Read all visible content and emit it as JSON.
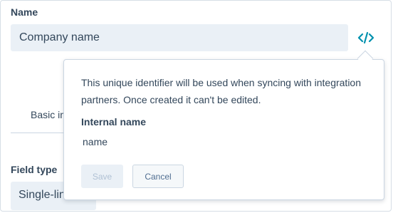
{
  "name_field": {
    "label": "Name",
    "value": "Company name"
  },
  "code_toggle": {
    "icon": "code-icon",
    "color": "#0091ae"
  },
  "tab": {
    "label": "Basic in"
  },
  "field_type": {
    "label": "Field type",
    "value": "Single-lin"
  },
  "popover": {
    "description": "This unique identifier will be used when syncing with integration partners. Once created it can't be edited.",
    "internal_name_label": "Internal name",
    "internal_name_value": "name",
    "save_label": "Save",
    "cancel_label": "Cancel"
  }
}
